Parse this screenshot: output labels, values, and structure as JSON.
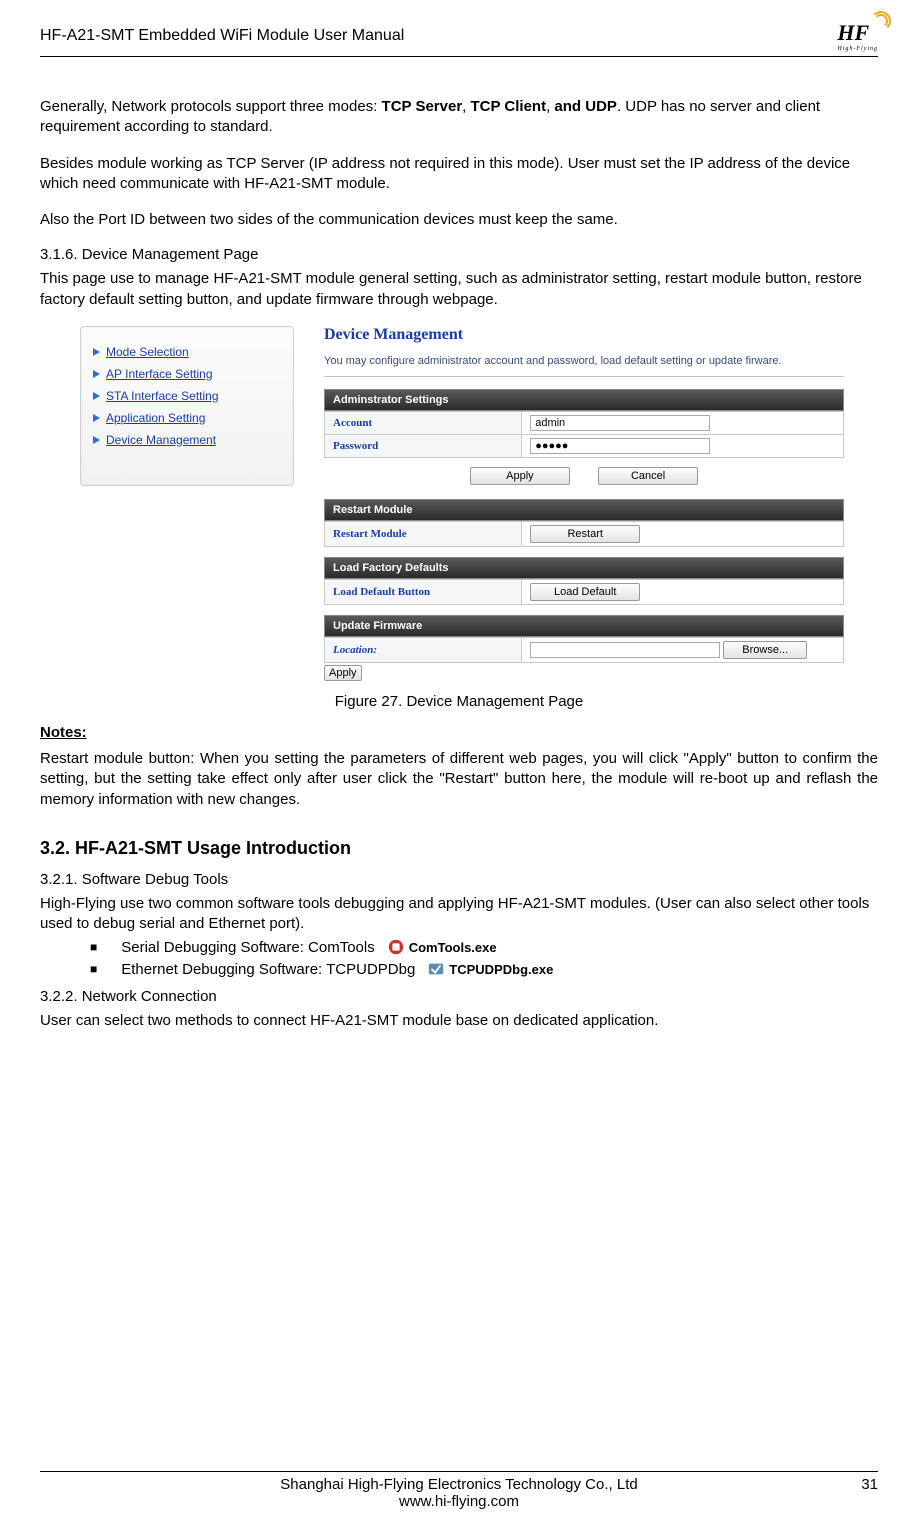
{
  "header": {
    "title": "HF-A21-SMT  Embedded WiFi Module User Manual",
    "logo_text": "HF",
    "logo_sub": "High-Flying"
  },
  "intro": {
    "p1_a": "Generally, Network protocols support three modes: ",
    "p1_b1": "TCP Server",
    "p1_c1": ", ",
    "p1_b2": "TCP Client",
    "p1_c2": ", ",
    "p1_b3": "and UDP",
    "p1_d": ". UDP has no server and client requirement according to standard.",
    "p2": "Besides module working as TCP Server (IP address not required in this mode). User must set the IP address of the device which need communicate with HF-A21-SMT module.",
    "p3": "Also the Port ID between two sides of the communication devices must keep the same."
  },
  "s316": {
    "heading": "3.1.6.    Device Management Page",
    "text": "This page use to manage HF-A21-SMT module general setting, such as administrator setting, restart module button, restore factory default setting button, and update firmware through webpage."
  },
  "nav": {
    "items": [
      "Mode Selection",
      "AP Interface Setting",
      "STA Interface Setting",
      "Application Setting",
      "Device Management"
    ]
  },
  "dm": {
    "title": "Device Management",
    "desc": "You may configure administrator account and password, load default setting or update firware.",
    "admin": {
      "bar": "Adminstrator Settings",
      "account_label": "Account",
      "account_value": "admin",
      "password_label": "Password",
      "password_value": "●●●●●",
      "apply": "Apply",
      "cancel": "Cancel"
    },
    "restart": {
      "bar": "Restart Module",
      "label": "Restart Module",
      "button": "Restart"
    },
    "load": {
      "bar": "Load Factory Defaults",
      "label": "Load Default Button",
      "button": "Load Default"
    },
    "fw": {
      "bar": "Update Firmware",
      "label": "Location:",
      "browse": "Browse...",
      "apply": "Apply"
    }
  },
  "figure": "Figure 27.    Device Management Page",
  "notes": {
    "heading": "Notes:",
    "text": "Restart module button: When you setting the parameters of different web pages, you will click \"Apply\" button to confirm the setting, but the setting take effect only after user click the \"Restart\" button here, the module will re-boot up and reflash the memory information with new changes."
  },
  "s32": {
    "heading": "3.2.   HF-A21-SMT Usage Introduction"
  },
  "s321": {
    "heading": "3.2.1.    Software Debug Tools",
    "text": "High-Flying use two common software tools debugging and applying HF-A21-SMT modules. (User can also select other tools used to debug serial and Ethernet port).",
    "bullets": [
      {
        "label": "Serial Debugging Software:  ComTools",
        "exe": "ComTools.exe"
      },
      {
        "label": "Ethernet Debugging Software: TCPUDPDbg",
        "exe": "TCPUDPDbg.exe"
      }
    ]
  },
  "s322": {
    "heading": "3.2.2.    Network Connection",
    "text": "User can select two methods to connect HF-A21-SMT module base on dedicated application."
  },
  "footer": {
    "company": "Shanghai High-Flying Electronics Technology Co., Ltd",
    "url": "www.hi-flying.com",
    "page": "31"
  }
}
